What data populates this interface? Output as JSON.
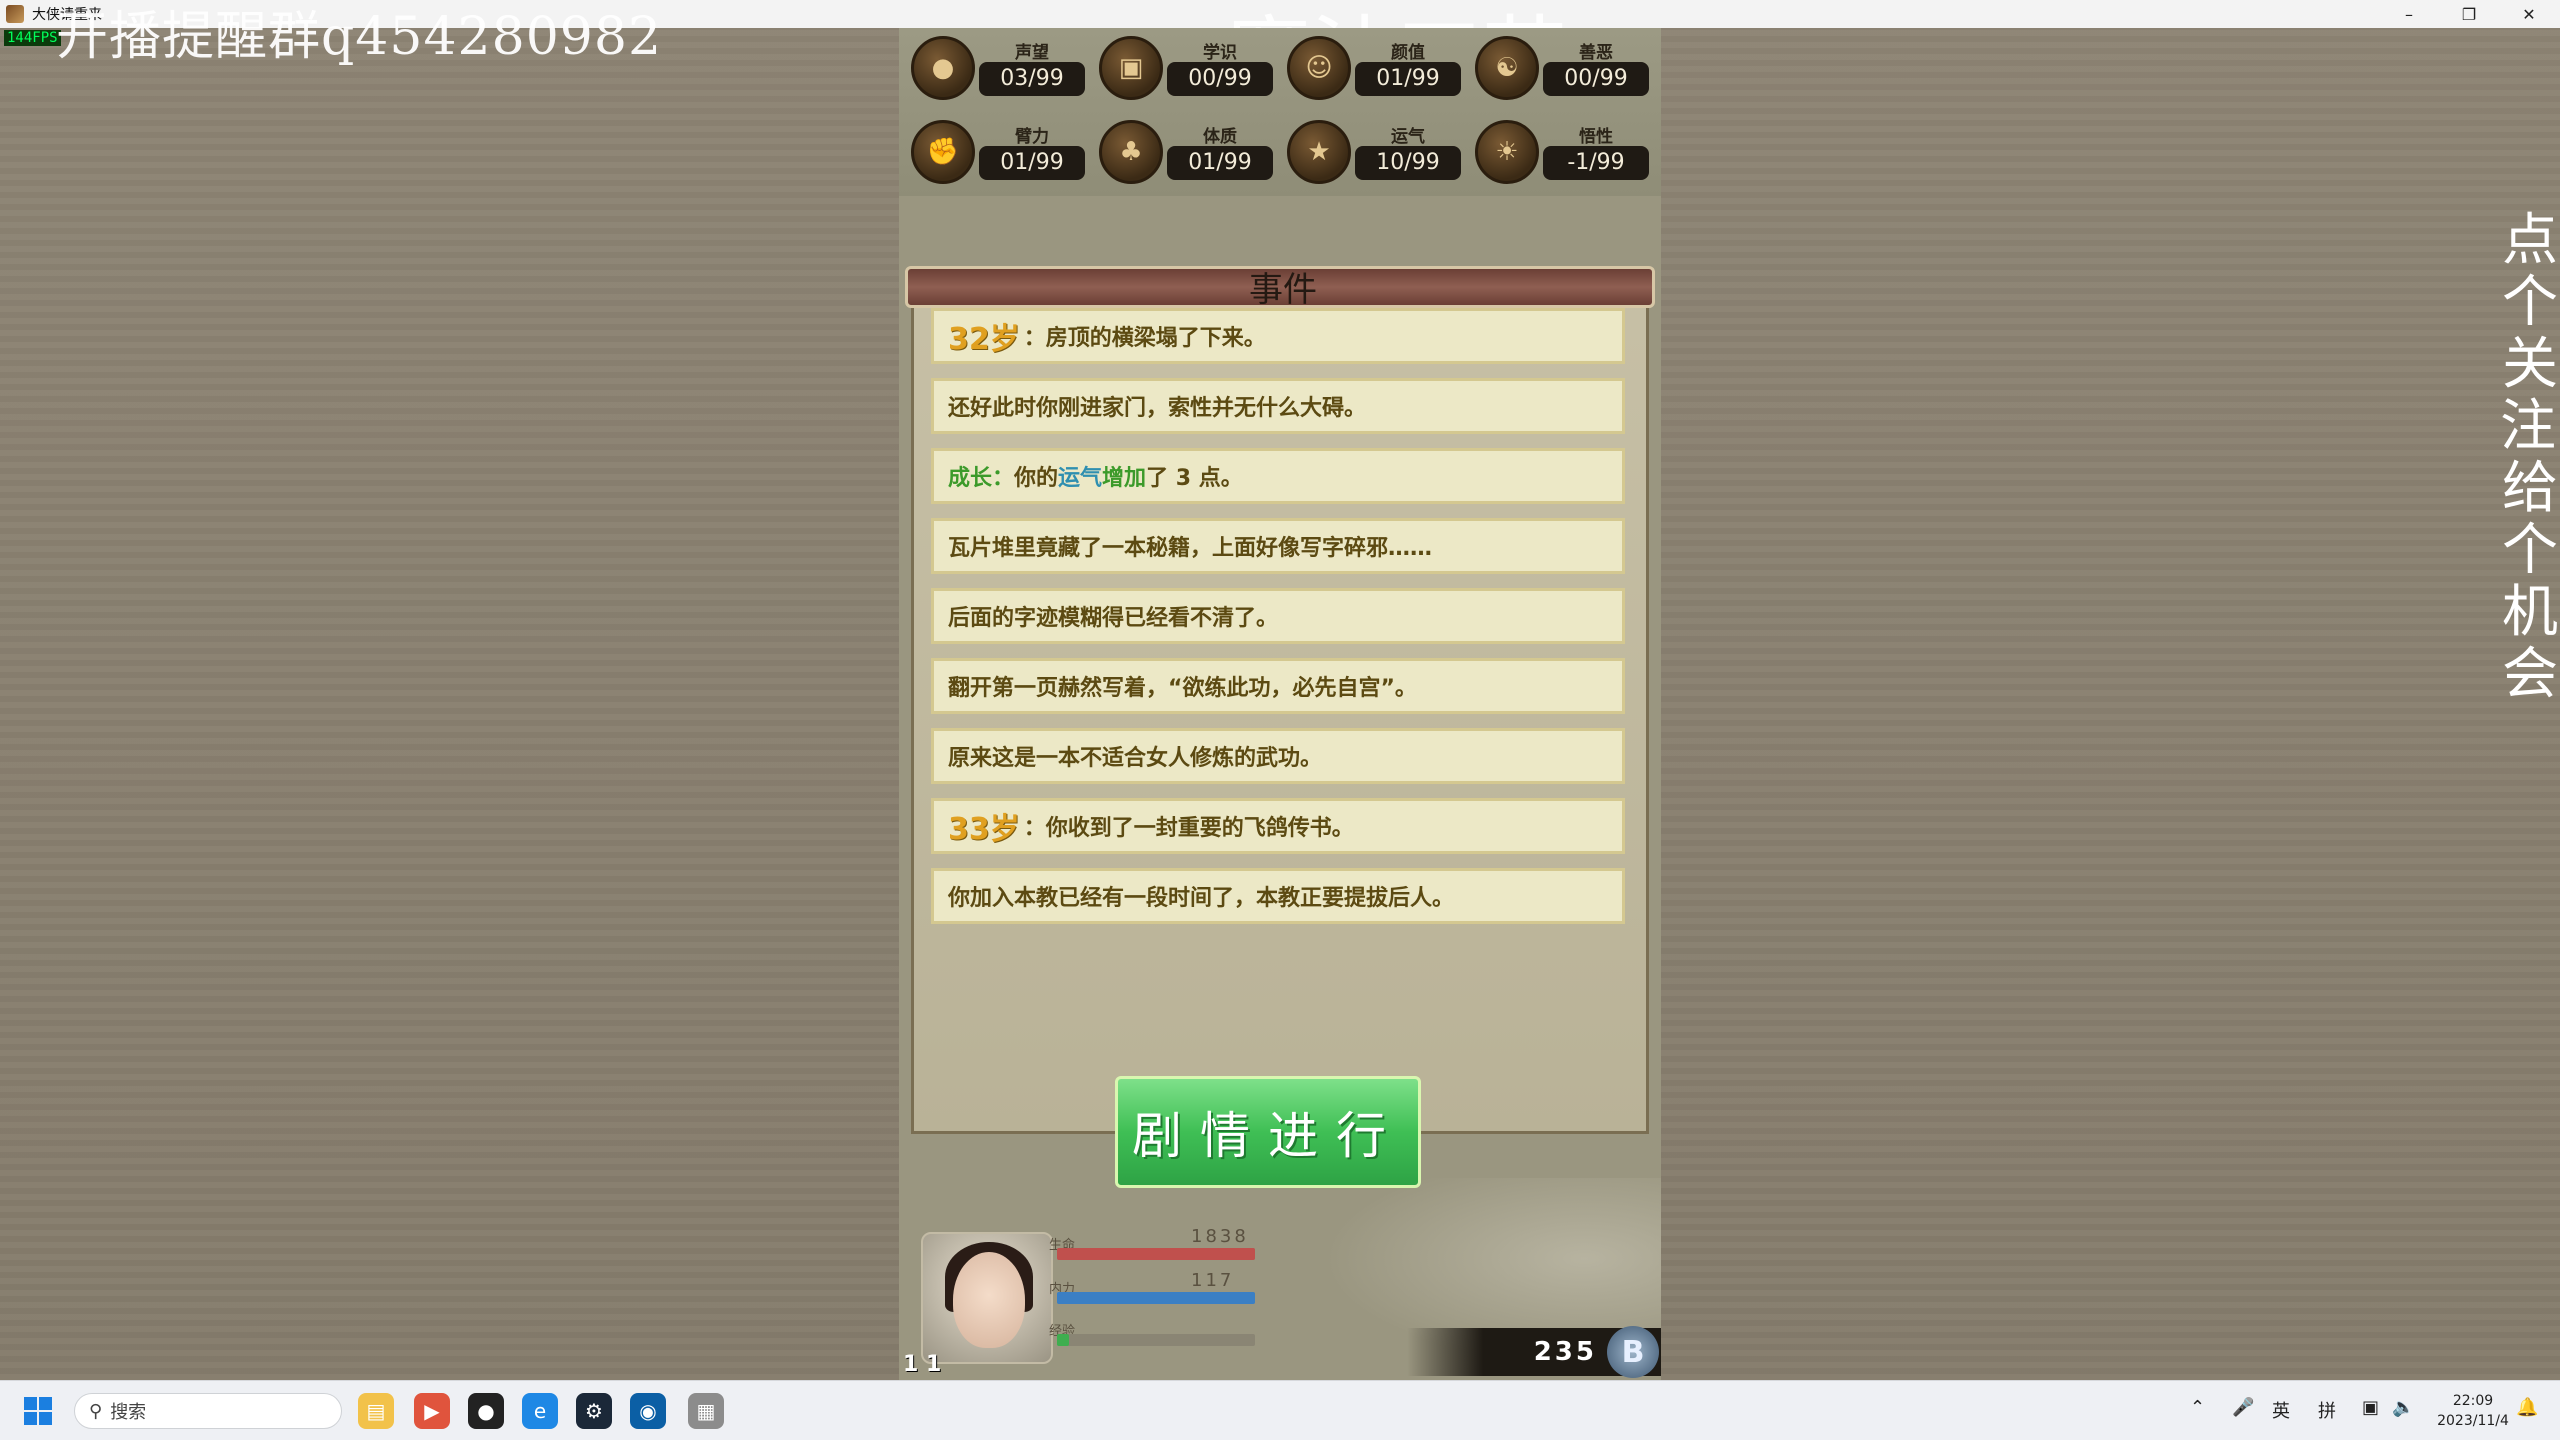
{
  "window": {
    "title": "大侠请重来",
    "fps": "144FPS"
  },
  "overlays": {
    "left": "开播提醒群q454280982",
    "center": "魔法工艺",
    "right": "点个关注，给个机会"
  },
  "stats": [
    {
      "label": "声望",
      "value": "03/99",
      "icon": "reputation-icon"
    },
    {
      "label": "学识",
      "value": "00/99",
      "icon": "knowledge-icon"
    },
    {
      "label": "颜值",
      "value": "01/99",
      "icon": "appearance-icon"
    },
    {
      "label": "善恶",
      "value": "00/99",
      "icon": "morality-icon"
    },
    {
      "label": "臂力",
      "value": "01/99",
      "icon": "strength-icon"
    },
    {
      "label": "体质",
      "value": "01/99",
      "icon": "constitution-icon"
    },
    {
      "label": "运气",
      "value": "10/99",
      "icon": "luck-icon"
    },
    {
      "label": "悟性",
      "value": "-1/99",
      "icon": "comprehension-icon"
    }
  ],
  "events_title": "事件",
  "events": [
    {
      "age": "32岁",
      "text": "房顶的横梁塌了下来。"
    },
    {
      "age": "",
      "text": "还好此时你刚进家门，索性并无什么大碍。"
    },
    {
      "age": "",
      "grow": "成长：",
      "pre": "你的",
      "hl": "运气",
      "mid": " 增加 ",
      "post": "了 3 点。"
    },
    {
      "age": "",
      "text": "瓦片堆里竟藏了一本秘籍，上面好像写字碎邪……"
    },
    {
      "age": "",
      "text": "后面的字迹模糊得已经看不清了。"
    },
    {
      "age": "",
      "text": "翻开第一页赫然写着，“欲练此功，必先自宫”。"
    },
    {
      "age": "",
      "text": "原来这是一本不适合女人修炼的武功。"
    },
    {
      "age": "33岁",
      "text": "你收到了一封重要的飞鸽传书。"
    },
    {
      "age": "",
      "text": "你加入本教已经有一段时间了，本教正要提拔后人。"
    }
  ],
  "continue_button": "剧情进行",
  "character": {
    "level": "1 1",
    "hp_value": "1838",
    "mp_value": "117",
    "hp_fraction": 1.0,
    "mp_fraction": 1.0,
    "exp_fraction": 0.06
  },
  "coins": "235",
  "coin_symbol": "B",
  "taskbar": {
    "search_placeholder": "搜索",
    "ime1": "英",
    "ime2": "拼",
    "time": "22:09",
    "date": "2023/11/4"
  },
  "colors": {
    "hp": "#c0504d",
    "mp": "#3b7fc4",
    "exp": "#3fae4f",
    "button": "#3fbf55"
  }
}
